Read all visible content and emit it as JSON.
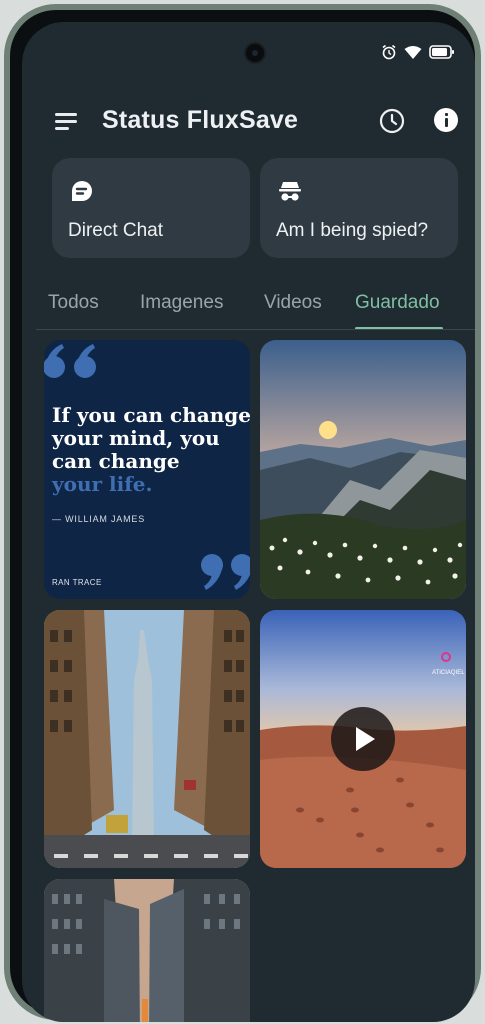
{
  "app": {
    "title": "Status FluxSave"
  },
  "status_bar": {
    "icons": [
      "alarm-icon",
      "wifi-icon",
      "battery-icon"
    ]
  },
  "appbar": {
    "icons": [
      "menu-icon",
      "history-icon",
      "info-icon"
    ]
  },
  "cards": [
    {
      "label": "Direct Chat",
      "icon": "chat-icon"
    },
    {
      "label": "Am I being spied?",
      "icon": "spy-icon"
    }
  ],
  "tabs": [
    {
      "label": "Todos",
      "active": false
    },
    {
      "label": "Imagenes",
      "active": false
    },
    {
      "label": "Videos",
      "active": false
    },
    {
      "label": "Guardado",
      "active": true
    }
  ],
  "gallery": {
    "quote": {
      "line1": "If you can change",
      "line2": "your mind, you",
      "line3": "can change",
      "line4": "your life.",
      "author": "— WILLIAM JAMES",
      "brand": "RAN TRACE"
    },
    "video_watermark": "ATICIAQIEL"
  },
  "colors": {
    "background": "#202a31",
    "card": "#2f3a42",
    "accent": "#7fbfa3",
    "text": "#eef1f3",
    "tab_inactive": "#9aa4ab"
  }
}
